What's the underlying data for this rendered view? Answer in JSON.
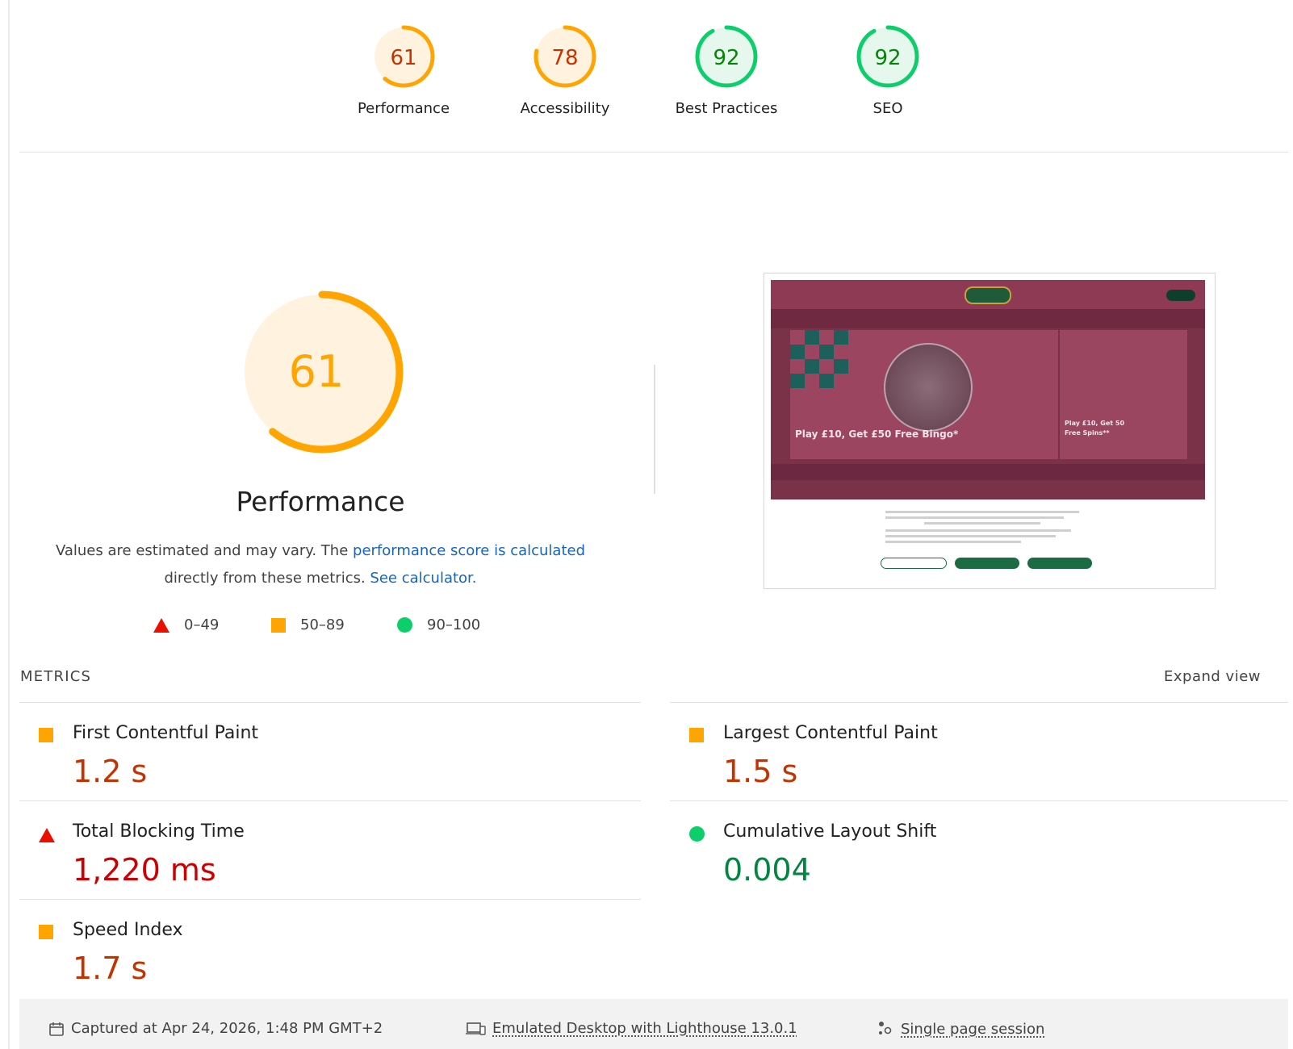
{
  "categories": [
    {
      "label": "Performance",
      "score": "61",
      "value": 0.61,
      "status": "average"
    },
    {
      "label": "Accessibility",
      "score": "78",
      "value": 0.78,
      "status": "average"
    },
    {
      "label": "Best Practices",
      "score": "92",
      "value": 0.92,
      "status": "pass"
    },
    {
      "label": "SEO",
      "score": "92",
      "value": 0.92,
      "status": "pass"
    }
  ],
  "colors": {
    "average": "#ffa400",
    "average_text": "#c33300",
    "average_bg": "#fff3e0",
    "pass": "#0cce6b",
    "pass_text": "#008800",
    "pass_bg": "#e6f8ee",
    "fail": "#eb0f00",
    "link": "#1565c0"
  },
  "performance": {
    "score": "61",
    "value": 0.61,
    "title": "Performance",
    "desc_prefix": "Values are estimated and may vary. The ",
    "desc_link": "performance score is calculated",
    "desc_mid": " directly from these metrics. ",
    "desc_link2": "See calculator.",
    "legend": [
      {
        "icon": "triangle-icon",
        "range": "0–49"
      },
      {
        "icon": "square-icon",
        "range": "50–89"
      },
      {
        "icon": "circle-icon",
        "range": "90–100"
      }
    ]
  },
  "thumbnail": {
    "hero_text": "Play £10, Get £50 Free Bingo*",
    "hero_text2": "Play £10, Get 50 Free Spins**"
  },
  "metrics": {
    "heading": "METRICS",
    "expand_label": "Expand view",
    "fcp": {
      "name": "First Contentful Paint",
      "value": "1.2 s"
    },
    "lcp": {
      "name": "Largest Contentful Paint",
      "value": "1.5 s"
    },
    "tbt": {
      "name": "Total Blocking Time",
      "value": "1,220 ms"
    },
    "cls": {
      "name": "Cumulative Layout Shift",
      "value": "0.004"
    },
    "si": {
      "name": "Speed Index",
      "value": "1.7 s"
    }
  },
  "footer": {
    "captured": "Captured at Apr 24, 2026, 1:48 PM GMT+2",
    "emulated": "Emulated Desktop with Lighthouse 13.0.1",
    "session": "Single page session"
  }
}
